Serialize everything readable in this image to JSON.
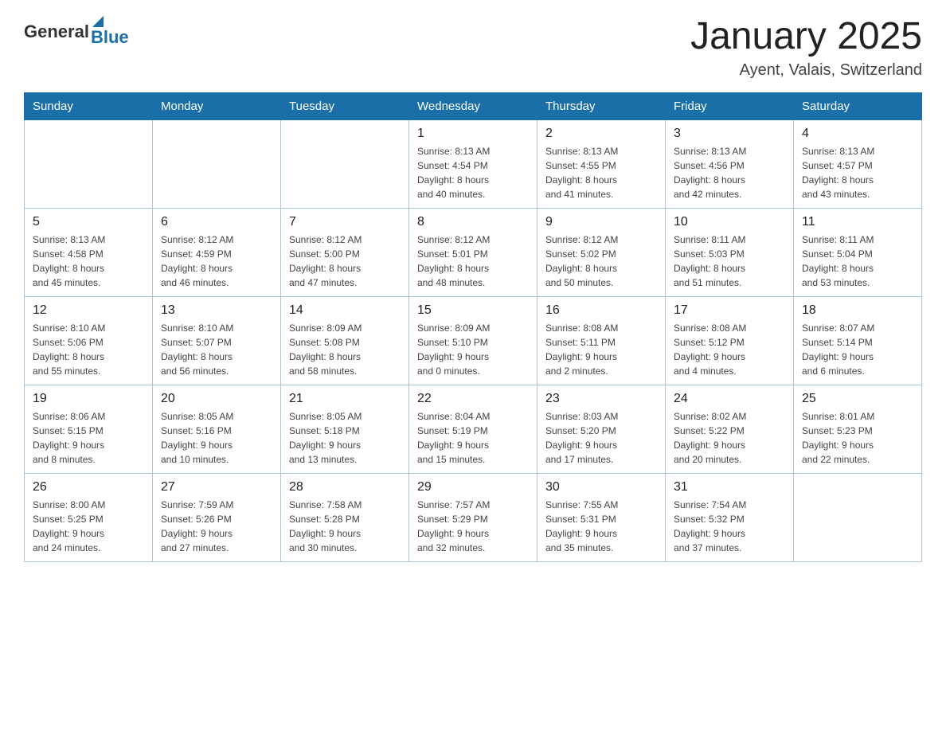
{
  "header": {
    "logo": {
      "text_general": "General",
      "text_blue": "Blue"
    },
    "title": "January 2025",
    "location": "Ayent, Valais, Switzerland"
  },
  "days_of_week": [
    "Sunday",
    "Monday",
    "Tuesday",
    "Wednesday",
    "Thursday",
    "Friday",
    "Saturday"
  ],
  "weeks": [
    {
      "days": [
        {
          "num": "",
          "info": ""
        },
        {
          "num": "",
          "info": ""
        },
        {
          "num": "",
          "info": ""
        },
        {
          "num": "1",
          "info": "Sunrise: 8:13 AM\nSunset: 4:54 PM\nDaylight: 8 hours\nand 40 minutes."
        },
        {
          "num": "2",
          "info": "Sunrise: 8:13 AM\nSunset: 4:55 PM\nDaylight: 8 hours\nand 41 minutes."
        },
        {
          "num": "3",
          "info": "Sunrise: 8:13 AM\nSunset: 4:56 PM\nDaylight: 8 hours\nand 42 minutes."
        },
        {
          "num": "4",
          "info": "Sunrise: 8:13 AM\nSunset: 4:57 PM\nDaylight: 8 hours\nand 43 minutes."
        }
      ]
    },
    {
      "days": [
        {
          "num": "5",
          "info": "Sunrise: 8:13 AM\nSunset: 4:58 PM\nDaylight: 8 hours\nand 45 minutes."
        },
        {
          "num": "6",
          "info": "Sunrise: 8:12 AM\nSunset: 4:59 PM\nDaylight: 8 hours\nand 46 minutes."
        },
        {
          "num": "7",
          "info": "Sunrise: 8:12 AM\nSunset: 5:00 PM\nDaylight: 8 hours\nand 47 minutes."
        },
        {
          "num": "8",
          "info": "Sunrise: 8:12 AM\nSunset: 5:01 PM\nDaylight: 8 hours\nand 48 minutes."
        },
        {
          "num": "9",
          "info": "Sunrise: 8:12 AM\nSunset: 5:02 PM\nDaylight: 8 hours\nand 50 minutes."
        },
        {
          "num": "10",
          "info": "Sunrise: 8:11 AM\nSunset: 5:03 PM\nDaylight: 8 hours\nand 51 minutes."
        },
        {
          "num": "11",
          "info": "Sunrise: 8:11 AM\nSunset: 5:04 PM\nDaylight: 8 hours\nand 53 minutes."
        }
      ]
    },
    {
      "days": [
        {
          "num": "12",
          "info": "Sunrise: 8:10 AM\nSunset: 5:06 PM\nDaylight: 8 hours\nand 55 minutes."
        },
        {
          "num": "13",
          "info": "Sunrise: 8:10 AM\nSunset: 5:07 PM\nDaylight: 8 hours\nand 56 minutes."
        },
        {
          "num": "14",
          "info": "Sunrise: 8:09 AM\nSunset: 5:08 PM\nDaylight: 8 hours\nand 58 minutes."
        },
        {
          "num": "15",
          "info": "Sunrise: 8:09 AM\nSunset: 5:10 PM\nDaylight: 9 hours\nand 0 minutes."
        },
        {
          "num": "16",
          "info": "Sunrise: 8:08 AM\nSunset: 5:11 PM\nDaylight: 9 hours\nand 2 minutes."
        },
        {
          "num": "17",
          "info": "Sunrise: 8:08 AM\nSunset: 5:12 PM\nDaylight: 9 hours\nand 4 minutes."
        },
        {
          "num": "18",
          "info": "Sunrise: 8:07 AM\nSunset: 5:14 PM\nDaylight: 9 hours\nand 6 minutes."
        }
      ]
    },
    {
      "days": [
        {
          "num": "19",
          "info": "Sunrise: 8:06 AM\nSunset: 5:15 PM\nDaylight: 9 hours\nand 8 minutes."
        },
        {
          "num": "20",
          "info": "Sunrise: 8:05 AM\nSunset: 5:16 PM\nDaylight: 9 hours\nand 10 minutes."
        },
        {
          "num": "21",
          "info": "Sunrise: 8:05 AM\nSunset: 5:18 PM\nDaylight: 9 hours\nand 13 minutes."
        },
        {
          "num": "22",
          "info": "Sunrise: 8:04 AM\nSunset: 5:19 PM\nDaylight: 9 hours\nand 15 minutes."
        },
        {
          "num": "23",
          "info": "Sunrise: 8:03 AM\nSunset: 5:20 PM\nDaylight: 9 hours\nand 17 minutes."
        },
        {
          "num": "24",
          "info": "Sunrise: 8:02 AM\nSunset: 5:22 PM\nDaylight: 9 hours\nand 20 minutes."
        },
        {
          "num": "25",
          "info": "Sunrise: 8:01 AM\nSunset: 5:23 PM\nDaylight: 9 hours\nand 22 minutes."
        }
      ]
    },
    {
      "days": [
        {
          "num": "26",
          "info": "Sunrise: 8:00 AM\nSunset: 5:25 PM\nDaylight: 9 hours\nand 24 minutes."
        },
        {
          "num": "27",
          "info": "Sunrise: 7:59 AM\nSunset: 5:26 PM\nDaylight: 9 hours\nand 27 minutes."
        },
        {
          "num": "28",
          "info": "Sunrise: 7:58 AM\nSunset: 5:28 PM\nDaylight: 9 hours\nand 30 minutes."
        },
        {
          "num": "29",
          "info": "Sunrise: 7:57 AM\nSunset: 5:29 PM\nDaylight: 9 hours\nand 32 minutes."
        },
        {
          "num": "30",
          "info": "Sunrise: 7:55 AM\nSunset: 5:31 PM\nDaylight: 9 hours\nand 35 minutes."
        },
        {
          "num": "31",
          "info": "Sunrise: 7:54 AM\nSunset: 5:32 PM\nDaylight: 9 hours\nand 37 minutes."
        },
        {
          "num": "",
          "info": ""
        }
      ]
    }
  ]
}
